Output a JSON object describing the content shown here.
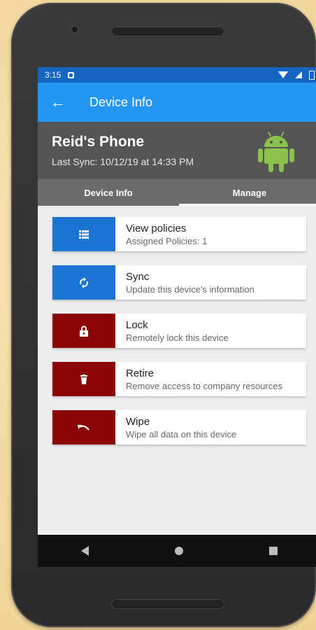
{
  "status_bar": {
    "time": "3:15"
  },
  "app_bar": {
    "back_icon": "←",
    "title": "Device Info"
  },
  "device": {
    "name": "Reid's Phone",
    "last_sync": "Last Sync: 10/12/19 at 14:33 PM",
    "icon": "android-icon",
    "icon_color": "#8bc34a"
  },
  "tabs": [
    {
      "label": "Device Info",
      "active": false
    },
    {
      "label": "Manage",
      "active": true
    }
  ],
  "actions": [
    {
      "title": "View policies",
      "subtitle": "Assigned Policies: 1",
      "icon": "list-icon",
      "color": "#1a74d1"
    },
    {
      "title": "Sync",
      "subtitle": "Update this device's information",
      "icon": "sync-icon",
      "color": "#1a74d1"
    },
    {
      "title": "Lock",
      "subtitle": "Remotely lock this device",
      "icon": "lock-icon",
      "color": "#8b0404"
    },
    {
      "title": "Retire",
      "subtitle": "Remove access to company resources",
      "icon": "trash-icon",
      "color": "#8b0404"
    },
    {
      "title": "Wipe",
      "subtitle": "Wipe all data on this device",
      "icon": "undo-icon",
      "color": "#8b0404"
    }
  ],
  "colors": {
    "status_bar": "#1565c0",
    "app_bar": "#2196f3",
    "header": "#555555",
    "tabs": "#6b6b6b",
    "blue_action": "#1a74d1",
    "red_action": "#8b0404"
  }
}
